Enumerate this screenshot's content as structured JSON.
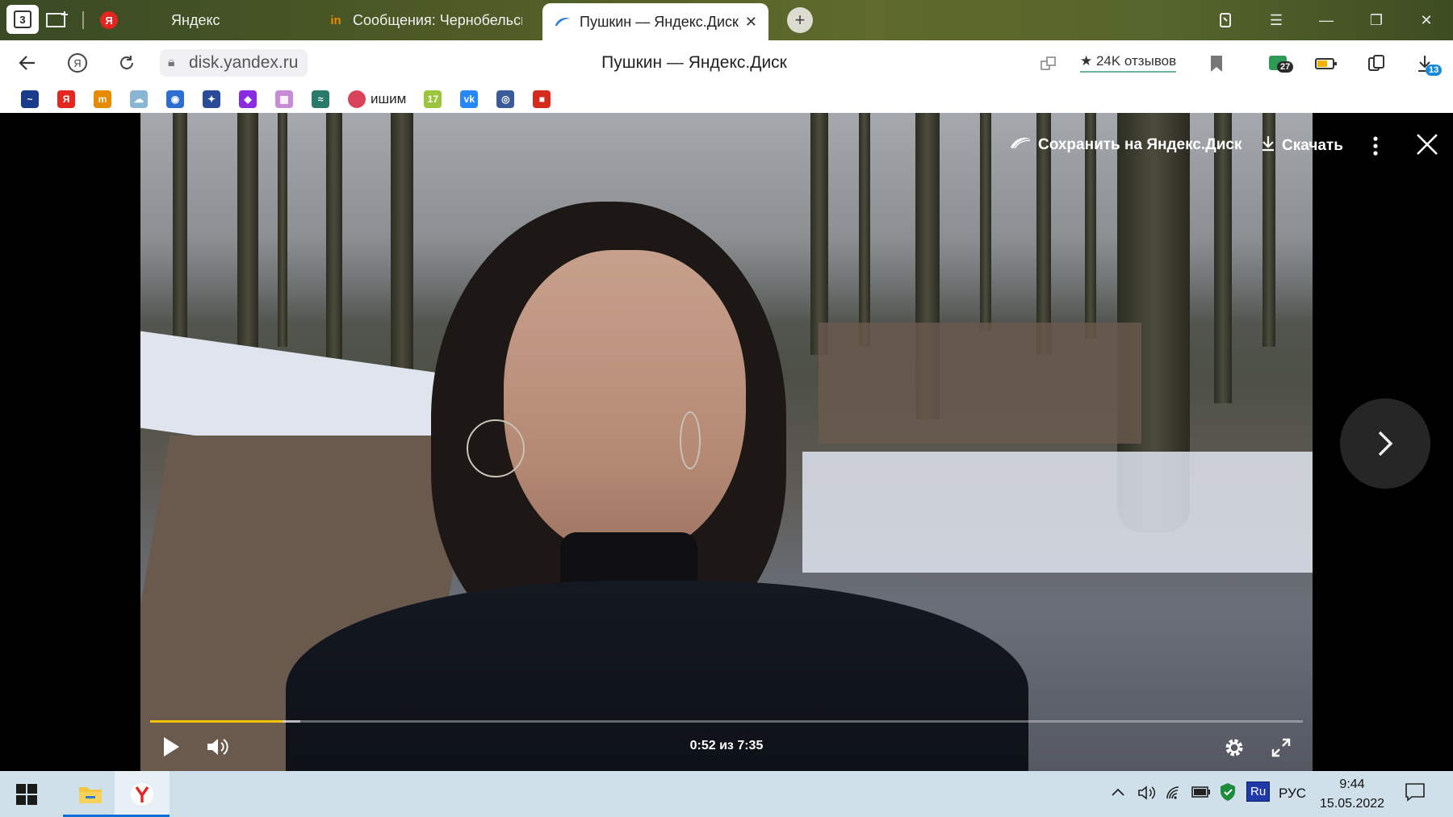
{
  "tabstrip": {
    "tab_count": "3",
    "tabs": [
      {
        "label": "Яндекс",
        "favicon": "Я",
        "color": "#e52620"
      },
      {
        "label": "Сообщения: Чернобельск",
        "favicon": "in",
        "color": "#e68a00"
      },
      {
        "label": "Пушкин — Яндекс.Диск",
        "favicon": "disk",
        "color": "#2d7de0"
      }
    ],
    "active_tab_close": "✕",
    "new_tab": "+"
  },
  "addressbar": {
    "url": "disk.yandex.ru",
    "page_title": "Пушкин — Яндекс.Диск",
    "reviews": "★ 24K отзывов",
    "extension_badge": "27",
    "downloads_badge": "13"
  },
  "bookmarks": {
    "items": [
      {
        "icon": "chart-icon",
        "color": "#1a3a8a",
        "glyph": "~"
      },
      {
        "icon": "yandex-icon",
        "color": "#e52620",
        "glyph": "Я"
      },
      {
        "icon": "mail-icon",
        "color": "#e68a00",
        "glyph": "m"
      },
      {
        "icon": "weather-icon",
        "color": "#8ab6d6",
        "glyph": "☁"
      },
      {
        "icon": "globe-icon",
        "color": "#2c6fd1",
        "glyph": "◉"
      },
      {
        "icon": "emblem-icon",
        "color": "#2a4b9a",
        "glyph": "✦"
      },
      {
        "icon": "feather-icon",
        "color": "#8a2be2",
        "glyph": "◆"
      },
      {
        "icon": "grid-icon",
        "color": "#c88bd6",
        "glyph": "▦"
      },
      {
        "icon": "wave-icon",
        "color": "#2a7a6a",
        "glyph": "≈"
      }
    ],
    "text_item": {
      "label": "ишим",
      "color": "#d8435a"
    },
    "items_after": [
      {
        "icon": "17-icon",
        "color": "#9bc53d",
        "glyph": "17"
      },
      {
        "icon": "vk-icon",
        "color": "#2787f5",
        "glyph": "vk"
      },
      {
        "icon": "seal-icon",
        "color": "#3a5a9a",
        "glyph": "◎"
      },
      {
        "icon": "russia-flag-icon",
        "color": "#d52b1e",
        "glyph": "■"
      }
    ]
  },
  "viewer": {
    "save_label": "Сохранить на Яндекс.Диск",
    "download_label": "Скачать",
    "time_text": "0:52 из 7:35",
    "played_fraction": 0.115,
    "buffered_fraction": 0.13,
    "accent_color": "#f5c400"
  },
  "taskbar": {
    "language": "РУС",
    "ime": "Ru",
    "time": "9:44",
    "date": "15.05.2022"
  }
}
